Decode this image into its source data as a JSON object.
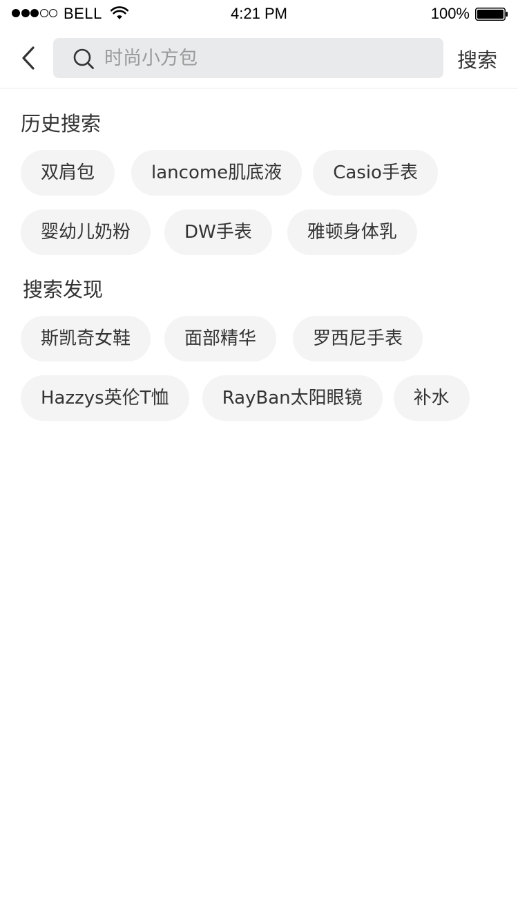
{
  "status_bar": {
    "signal_bars": [
      true,
      true,
      true,
      false,
      false
    ],
    "carrier": "BELL",
    "time": "4:21 PM",
    "battery_percent": "100%",
    "battery_level": 1.0
  },
  "nav": {
    "back_icon": "chevron-left-icon",
    "search_icon": "search-icon",
    "search_placeholder": "时尚小方包",
    "search_value": "",
    "search_button_label": "搜索"
  },
  "history": {
    "title": "历史搜索",
    "rows": [
      [
        "双肩包",
        "lancome肌底液",
        "Casio手表"
      ],
      [
        "婴幼儿奶粉",
        "DW手表",
        "雅顿身体乳"
      ]
    ]
  },
  "discover": {
    "title": "搜索发现",
    "rows": [
      [
        "斯凯奇女鞋",
        "面部精华",
        "罗西尼手表"
      ],
      [
        "Hazzys英伦T恤",
        "RayBan太阳眼镜",
        "补水"
      ]
    ]
  },
  "colors": {
    "background": "#ffffff",
    "search_box_bg": "#e9eaec",
    "tag_bg": "#f4f4f4",
    "text": "#333333",
    "placeholder": "#9a9a9a",
    "divider": "#e8e8e8"
  }
}
